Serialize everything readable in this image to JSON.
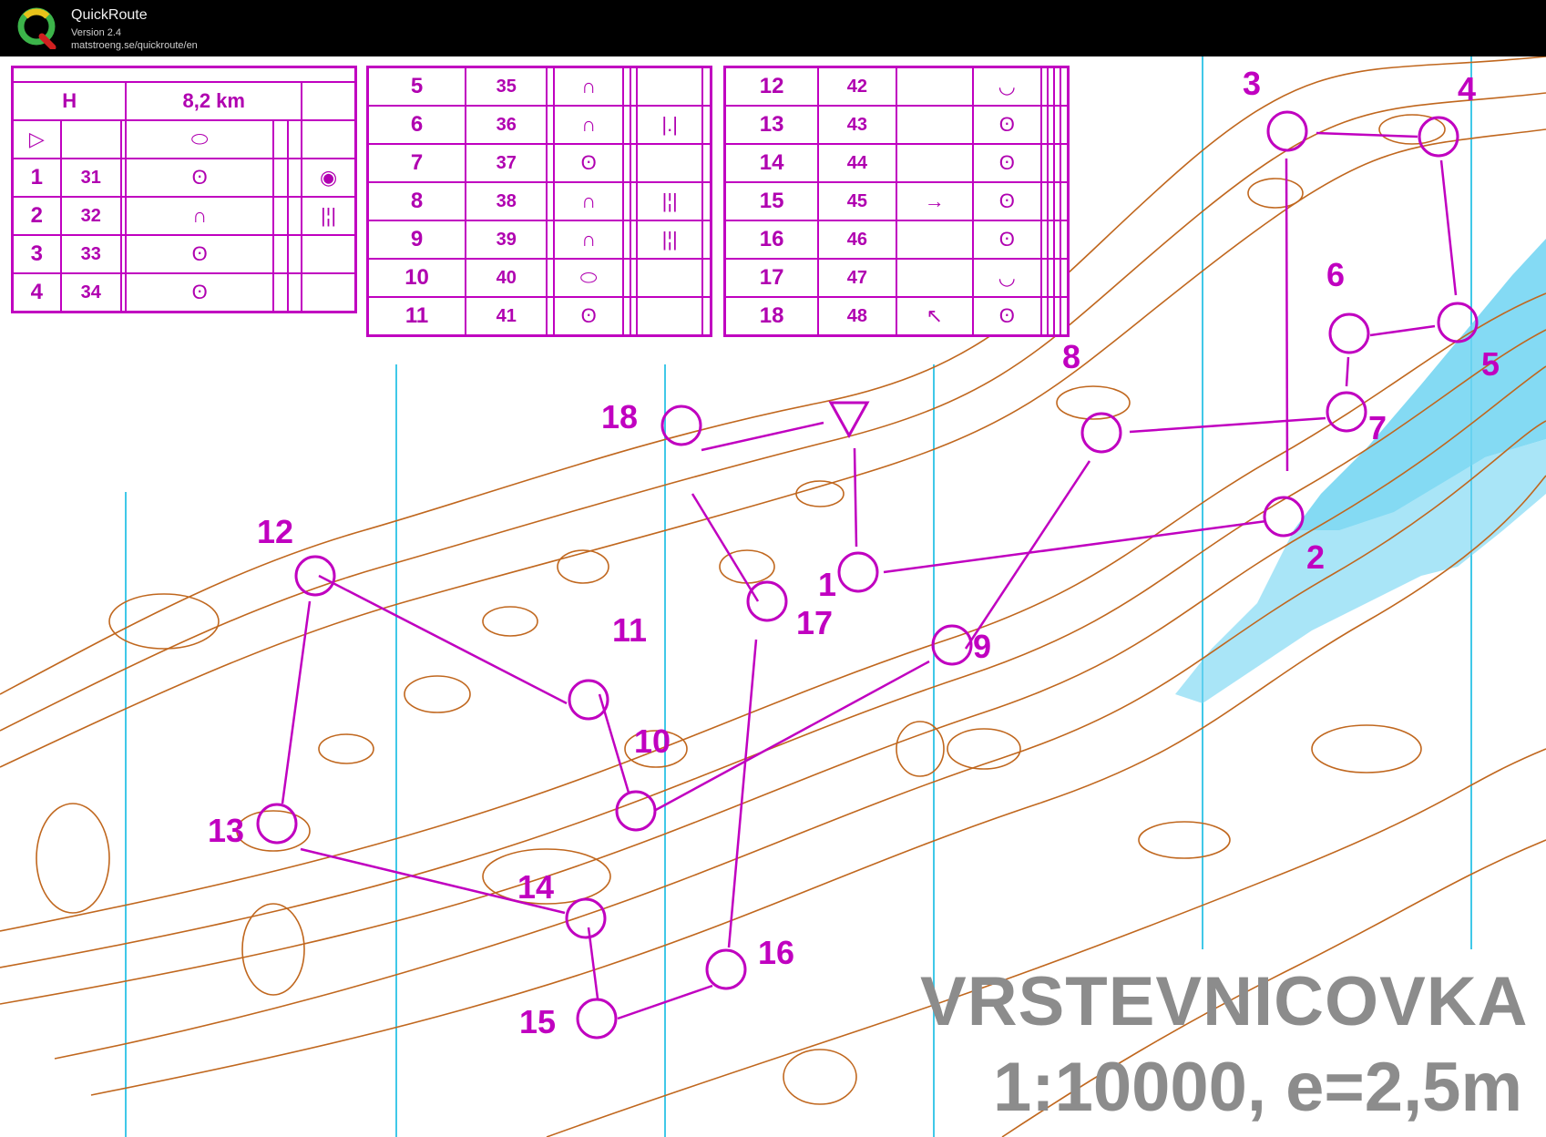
{
  "app": {
    "name": "QuickRoute",
    "version": "Version 2.4",
    "url": "matstroeng.se/quickroute/en"
  },
  "colors": {
    "overprint": "#c000c0",
    "contour": "#c0671e",
    "water": "#5fd0f0",
    "grid": "#40c8e8",
    "watermark": "#8c8c8c"
  },
  "map": {
    "title": "VRSTEVNICOVKA",
    "scale_text": "1:10000, e=2,5m",
    "course": {
      "class": "H",
      "length": "8,2 km",
      "start_symbol": "▷",
      "controls": [
        {
          "num": "1",
          "code": "31",
          "feature": "ʘ",
          "extra": "◉"
        },
        {
          "num": "2",
          "code": "32",
          "feature": "∩",
          "extra": "|¦|"
        },
        {
          "num": "3",
          "code": "33",
          "feature": "ʘ",
          "extra": ""
        },
        {
          "num": "4",
          "code": "34",
          "feature": "ʘ",
          "extra": ""
        },
        {
          "num": "5",
          "code": "35",
          "feature": "∩",
          "extra": ""
        },
        {
          "num": "6",
          "code": "36",
          "feature": "∩",
          "extra": "|.|"
        },
        {
          "num": "7",
          "code": "37",
          "feature": "ʘ",
          "extra": ""
        },
        {
          "num": "8",
          "code": "38",
          "feature": "∩",
          "extra": "|¦|"
        },
        {
          "num": "9",
          "code": "39",
          "feature": "∩",
          "extra": "|¦|"
        },
        {
          "num": "10",
          "code": "40",
          "feature": "⬭",
          "extra": ""
        },
        {
          "num": "11",
          "code": "41",
          "feature": "ʘ",
          "extra": ""
        },
        {
          "num": "12",
          "code": "42",
          "feature": "◡",
          "extra": ""
        },
        {
          "num": "13",
          "code": "43",
          "feature": "ʘ",
          "extra": ""
        },
        {
          "num": "14",
          "code": "44",
          "feature": "ʘ",
          "extra": ""
        },
        {
          "num": "15",
          "code": "45",
          "feature": "ʘ",
          "extra": "→"
        },
        {
          "num": "16",
          "code": "46",
          "feature": "ʘ",
          "extra": ""
        },
        {
          "num": "17",
          "code": "47",
          "feature": "◡",
          "extra": ""
        },
        {
          "num": "18",
          "code": "48",
          "feature": "ʘ",
          "extra": "↖"
        }
      ],
      "map_labels": [
        "1",
        "2",
        "3",
        "4",
        "5",
        "6",
        "7",
        "8",
        "9",
        "10",
        "11",
        "12",
        "13",
        "14",
        "15",
        "16",
        "17",
        "18"
      ]
    }
  }
}
